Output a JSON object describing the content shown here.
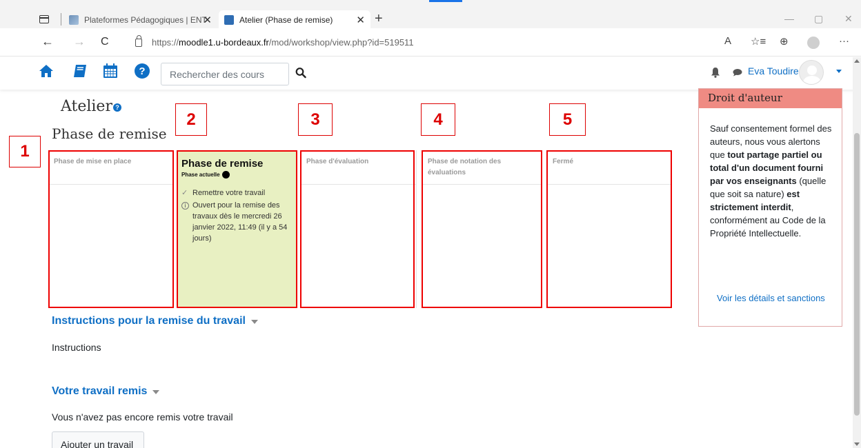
{
  "browser": {
    "tabs": [
      {
        "title": "Plateformes Pédagogiques | ENT",
        "close": "✕"
      },
      {
        "title": "Atelier (Phase de remise)",
        "close": "✕"
      }
    ],
    "new_tab": "+",
    "url_prefix": "https://",
    "url_host": "moodle1.u-bordeaux.fr",
    "url_path": "/mod/workshop/view.php?id=519511",
    "window_controls": {
      "minimize": "—",
      "maximize": "▢",
      "close": "✕"
    },
    "nav": {
      "back": "←",
      "forward": "→",
      "refresh": "C"
    },
    "tools": {
      "read_aloud": "A",
      "favorites": "☆≡",
      "collections": "⊕",
      "more": "···"
    }
  },
  "moodle_nav": {
    "search_placeholder": "Rechercher des cours",
    "user_name": "Eva Toudire",
    "brand_color": "#0f6fc5"
  },
  "main": {
    "title": "Atelier",
    "help_glyph": "?",
    "phase_heading": "Phase de remise",
    "phases": [
      {
        "name": "Phase de mise en place"
      },
      {
        "name": "Phase de remise",
        "current_label": "Phase actuelle",
        "tasks": [
          {
            "icon": "check-icon",
            "glyph": "✓",
            "text": "Remettre votre travail"
          },
          {
            "icon": "info-icon",
            "glyph": "i",
            "text": "Ouvert pour la remise des travaux dès le mercredi 26 janvier 2022, 11:49 (il y a 54 jours)"
          }
        ]
      },
      {
        "name": "Phase d'évaluation"
      },
      {
        "name": "Phase de notation des évaluations"
      },
      {
        "name": "Fermé"
      }
    ],
    "annotations": [
      "1",
      "2",
      "3",
      "4",
      "5"
    ],
    "instructions_heading": "Instructions pour la remise du travail",
    "instructions_text": "Instructions",
    "submission_heading": "Votre travail remis",
    "submission_status": "Vous n'avez pas encore remis votre travail",
    "add_button": "Ajouter un travail"
  },
  "copyright_block": {
    "title": "Droit d'auteur",
    "text_1": "Sauf consentement formel des auteurs, nous vous alertons que ",
    "bold_1": "tout partage partiel ou total d'un document fourni par vos enseignants",
    "text_2": " (quelle que soit sa nature) ",
    "bold_2": "est strictement interdit",
    "text_3": ", conformément au Code de la Propriété Intellectuelle.",
    "link": "Voir les détails et sanctions",
    "header_color": "#ef8b83"
  },
  "colors": {
    "active_phase": "#e8f0c2",
    "annotation_red": "#e00000"
  }
}
